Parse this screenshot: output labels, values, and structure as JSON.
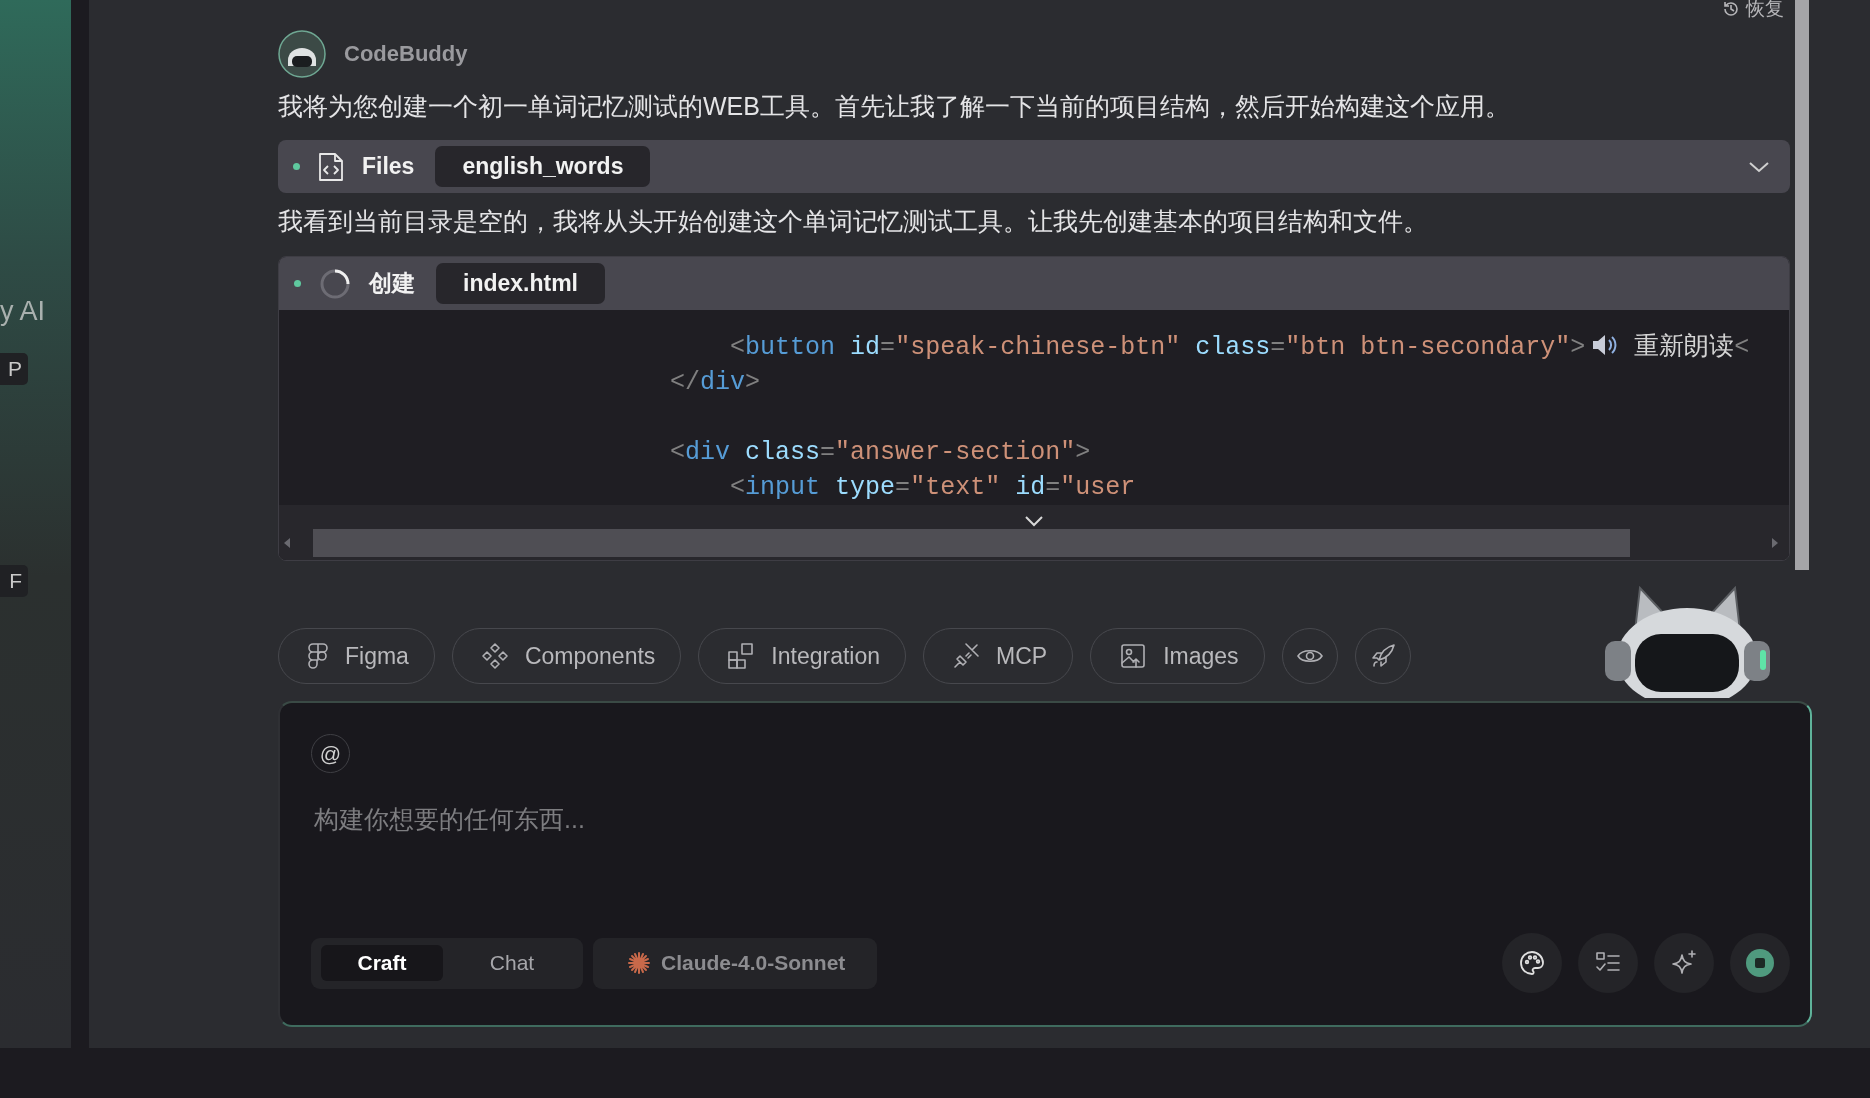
{
  "sidebar": {
    "title_fragment": "y AI",
    "shortcuts": [
      "P",
      "F"
    ]
  },
  "restore": "恢复",
  "message": {
    "author": "CodeBuddy",
    "blocks": [
      {
        "kind": "text",
        "text": "我将为您创建一个初一单词记忆测试的WEB工具。首先让我了解一下当前的项目结构，然后开始构建这个应用。"
      },
      {
        "kind": "tool",
        "running": false,
        "label": "Files",
        "target": "english_words",
        "expanded": false
      },
      {
        "kind": "text",
        "text": "我看到当前目录是空的，我将从头开始创建这个单词记忆测试工具。让我先创建基本的项目结构和文件。"
      },
      {
        "kind": "tool",
        "running": true,
        "label": "创建",
        "target": "index.html",
        "expanded": true,
        "code": [
          {
            "kind": "code",
            "tokens": [
              {
                "kind": "punct",
                "s": "                            <"
              },
              {
                "kind": "tag",
                "s": "button"
              },
              {
                "kind": "attr",
                "s": " id"
              },
              {
                "kind": "punct",
                "s": "="
              },
              {
                "kind": "str",
                "s": "\"speak-chinese-btn\""
              },
              {
                "kind": "attr",
                "s": " class"
              },
              {
                "kind": "punct",
                "s": "="
              },
              {
                "kind": "str",
                "s": "\"btn btn-secondary\""
              },
              {
                "kind": "punct",
                "s": ">"
              },
              {
                "kind": "icon"
              },
              {
                "kind": "plain",
                "s": " 重新朗读"
              },
              {
                "kind": "punct",
                "s": "<"
              }
            ]
          },
          {
            "kind": "code",
            "tokens": [
              {
                "kind": "punct",
                "s": "                        </"
              },
              {
                "kind": "tag",
                "s": "div"
              },
              {
                "kind": "punct",
                "s": ">"
              }
            ]
          },
          {
            "kind": "blank"
          },
          {
            "kind": "code",
            "tokens": [
              {
                "kind": "punct",
                "s": "                        <"
              },
              {
                "kind": "tag",
                "s": "div"
              },
              {
                "kind": "attr",
                "s": " class"
              },
              {
                "kind": "punct",
                "s": "="
              },
              {
                "kind": "str",
                "s": "\"answer-section\""
              },
              {
                "kind": "punct",
                "s": ">"
              }
            ]
          },
          {
            "kind": "code",
            "tokens": [
              {
                "kind": "punct",
                "s": "                            <"
              },
              {
                "kind": "tag",
                "s": "input"
              },
              {
                "kind": "attr",
                "s": " type"
              },
              {
                "kind": "punct",
                "s": "="
              },
              {
                "kind": "str",
                "s": "\"text\""
              },
              {
                "kind": "attr",
                "s": " id"
              },
              {
                "kind": "punct",
                "s": "="
              },
              {
                "kind": "str",
                "s": "\"user"
              }
            ]
          }
        ]
      }
    ]
  },
  "toolbar": [
    "Figma",
    "Components",
    "Integration",
    "MCP",
    "Images"
  ],
  "composer": {
    "mention": "@",
    "placeholder": "构建你想要的任何东西...",
    "modes": [
      {
        "label": "Craft",
        "selected": true
      },
      {
        "label": "Chat",
        "selected": false
      }
    ],
    "model": "Claude-4.0-Sonnet"
  }
}
